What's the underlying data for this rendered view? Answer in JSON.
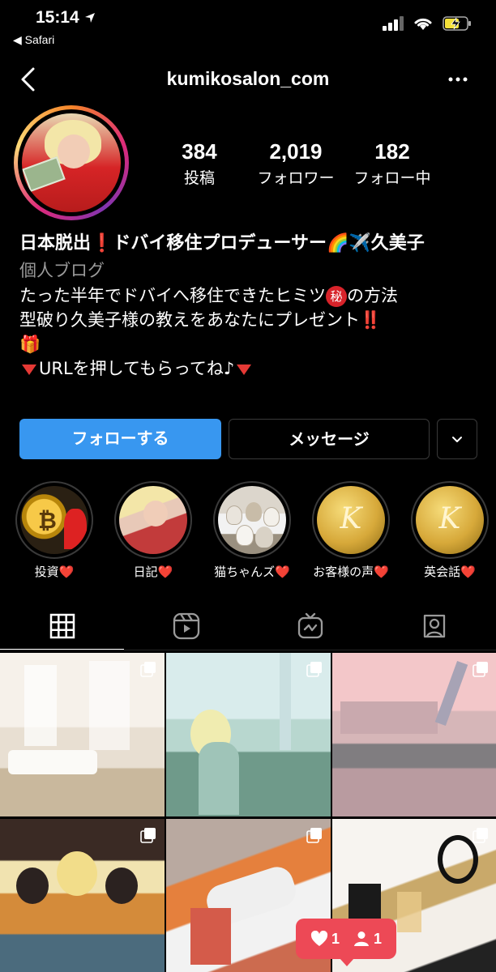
{
  "status_bar": {
    "time": "15:14",
    "back_app": "◀ Safari"
  },
  "nav": {
    "username": "kumikosalon_com"
  },
  "stats": [
    {
      "value": "384",
      "label": "投稿"
    },
    {
      "value": "2,019",
      "label": "フォロワー"
    },
    {
      "value": "182",
      "label": "フォロー中"
    }
  ],
  "bio": {
    "name_a": "日本脱出",
    "name_b": "ドバイ移住プロデューサー🌈✈️久美子",
    "category": "個人ブログ",
    "line1_a": "たった半年でドバイへ移住できたヒミツ",
    "secret_char": "秘",
    "line1_b": "の方法",
    "line2": "型破り久美子様の教えをあなたにプレゼント",
    "line2_mark": "‼️",
    "gift": "🎁",
    "line3": "URLを押してもらってね♪"
  },
  "actions": {
    "follow": "フォローする",
    "message": "メッセージ"
  },
  "highlights": [
    {
      "label": "投資",
      "heart": "❤️"
    },
    {
      "label": "日記",
      "heart": "❤️"
    },
    {
      "label": "猫ちゃんズ",
      "heart": "❤️"
    },
    {
      "label": "お客様の声",
      "heart": "❤️"
    },
    {
      "label": "英会話",
      "heart": "❤️"
    }
  ],
  "highlight_logo_letter": "K",
  "notifications": {
    "likes": "1",
    "follows": "1"
  },
  "colors": {
    "follow_button": "#3897f0",
    "notification": "#ed4956",
    "background": "#000000"
  }
}
